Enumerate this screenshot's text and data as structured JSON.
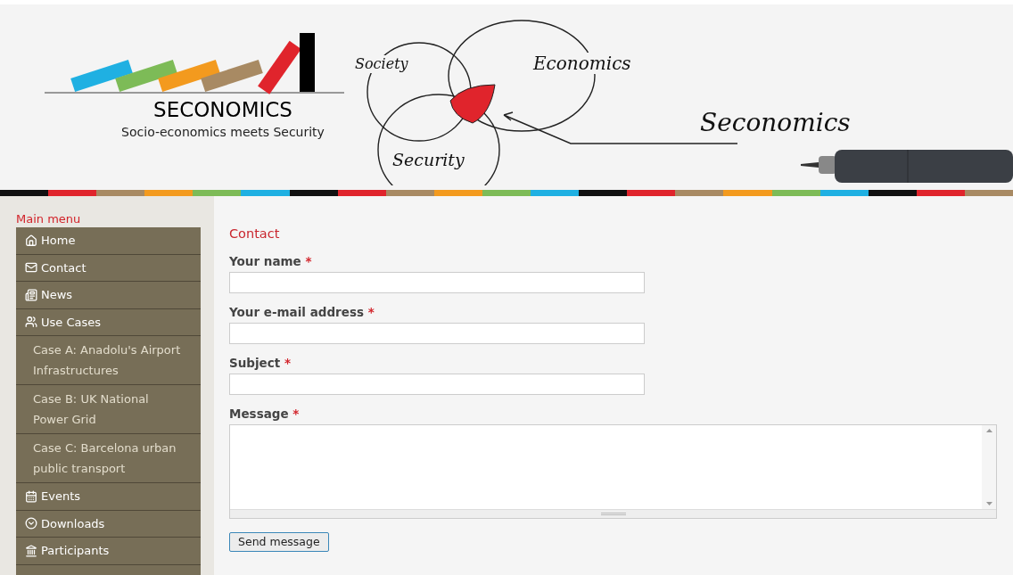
{
  "header": {
    "logo_title": "SECONOMICS",
    "tagline": "Socio-economics meets Security",
    "sketch_labels": [
      "Society",
      "Economics",
      "Security",
      "Seconomics"
    ]
  },
  "sidebar": {
    "title": "Main menu",
    "items": [
      {
        "label": "Home",
        "kind": "home"
      },
      {
        "label": "Contact",
        "kind": "mail"
      },
      {
        "label": "News",
        "kind": "news"
      },
      {
        "label": "Use Cases",
        "kind": "users"
      },
      {
        "label": "Case A: Anadolu's Airport Infrastructures",
        "kind": "sub"
      },
      {
        "label": "Case B: UK National Power Grid",
        "kind": "sub"
      },
      {
        "label": "Case C: Barcelona urban public transport",
        "kind": "sub"
      },
      {
        "label": "Events",
        "kind": "calendar"
      },
      {
        "label": "Downloads",
        "kind": "download"
      },
      {
        "label": "Participants",
        "kind": "landmark"
      }
    ]
  },
  "form": {
    "title": "Contact",
    "fields": [
      {
        "label": "Your name",
        "required": true,
        "kind": "input"
      },
      {
        "label": "Your e-mail address",
        "required": true,
        "kind": "input"
      },
      {
        "label": "Subject",
        "required": true,
        "kind": "input"
      },
      {
        "label": "Message",
        "required": true,
        "kind": "textarea"
      }
    ],
    "required_mark": "*",
    "submit": "Send message"
  }
}
